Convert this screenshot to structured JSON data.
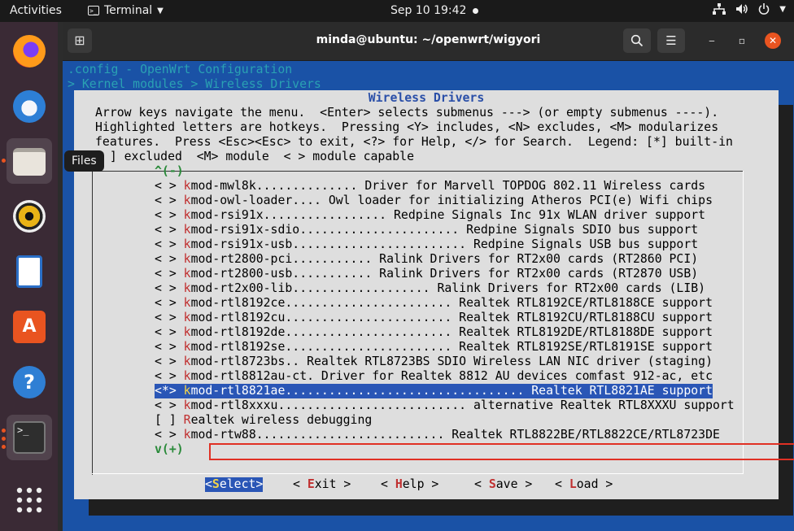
{
  "topbar": {
    "activities": "Activities",
    "app_name": "Terminal",
    "clock": "Sep 10  19:42",
    "tray_icons": [
      "network-icon",
      "volume-icon",
      "power-icon"
    ]
  },
  "dock": {
    "items": [
      "firefox",
      "thunderbird",
      "files",
      "rhythmbox",
      "libreoffice-writer",
      "software",
      "help",
      "terminal",
      "show-apps"
    ],
    "tooltip": "Files"
  },
  "window": {
    "title": "minda@ubuntu: ~/openwrt/wigyori"
  },
  "terminal": {
    "bg_line1": ".config - OpenWrt Configuration",
    "bg_line2": "> Kernel modules > Wireless Drivers",
    "dialog_title": "Wireless Drivers",
    "help_lines": [
      "Arrow keys navigate the menu.  <Enter> selects submenus ---> (or empty submenus ----).",
      "Highlighted letters are hotkeys.  Pressing <Y> includes, <N> excludes, <M> modularizes",
      "features.  Press <Esc><Esc> to exit, <?> for Help, </> for Search.  Legend: [*] built-in",
      "[ ] excluded  <M> module  < > module capable"
    ],
    "scroll_up": "^(-)",
    "scroll_down": "v(+)",
    "items": [
      {
        "prefix": "< > ",
        "hot": "k",
        "rest": "mod-mwl8k.............. Driver for Marvell TOPDOG 802.11 Wireless cards"
      },
      {
        "prefix": "< > ",
        "hot": "k",
        "rest": "mod-owl-loader.... Owl loader for initializing Atheros PCI(e) Wifi chips"
      },
      {
        "prefix": "< > ",
        "hot": "k",
        "rest": "mod-rsi91x................. Redpine Signals Inc 91x WLAN driver support"
      },
      {
        "prefix": "< > ",
        "hot": "k",
        "rest": "mod-rsi91x-sdio...................... Redpine Signals SDIO bus support"
      },
      {
        "prefix": "< > ",
        "hot": "k",
        "rest": "mod-rsi91x-usb........................ Redpine Signals USB bus support"
      },
      {
        "prefix": "< > ",
        "hot": "k",
        "rest": "mod-rt2800-pci........... Ralink Drivers for RT2x00 cards (RT2860 PCI)"
      },
      {
        "prefix": "< > ",
        "hot": "k",
        "rest": "mod-rt2800-usb........... Ralink Drivers for RT2x00 cards (RT2870 USB)"
      },
      {
        "prefix": "< > ",
        "hot": "k",
        "rest": "mod-rt2x00-lib................... Ralink Drivers for RT2x00 cards (LIB)"
      },
      {
        "prefix": "< > ",
        "hot": "k",
        "rest": "mod-rtl8192ce....................... Realtek RTL8192CE/RTL8188CE support"
      },
      {
        "prefix": "< > ",
        "hot": "k",
        "rest": "mod-rtl8192cu....................... Realtek RTL8192CU/RTL8188CU support"
      },
      {
        "prefix": "< > ",
        "hot": "k",
        "rest": "mod-rtl8192de....................... Realtek RTL8192DE/RTL8188DE support"
      },
      {
        "prefix": "< > ",
        "hot": "k",
        "rest": "mod-rtl8192se....................... Realtek RTL8192SE/RTL8191SE support"
      },
      {
        "prefix": "< > ",
        "hot": "k",
        "rest": "mod-rtl8723bs.. Realtek RTL8723BS SDIO Wireless LAN NIC driver (staging)"
      },
      {
        "prefix": "< > ",
        "hot": "k",
        "rest": "mod-rtl8812au-ct. Driver for Realtek 8812 AU devices comfast 912-ac, etc"
      },
      {
        "prefix": "<*> ",
        "hot": "k",
        "rest": "mod-rtl8821ae................................. Realtek RTL8821AE support"
      },
      {
        "prefix": "< > ",
        "hot": "k",
        "rest": "mod-rtl8xxxu.......................... alternative Realtek RTL8XXXU support"
      },
      {
        "prefix": "[ ] ",
        "hot": "R",
        "rest": "ealtek wireless debugging"
      },
      {
        "prefix": "< > ",
        "hot": "k",
        "rest": "mod-rtw88.......................... Realtek RTL8822BE/RTL8822CE/RTL8723DE"
      }
    ],
    "buttons": [
      {
        "pre": "<",
        "hk": "S",
        "post": "elect>"
      },
      {
        "pre": "< ",
        "hk": "E",
        "post": "xit >"
      },
      {
        "pre": "< ",
        "hk": "H",
        "post": "elp >"
      },
      {
        "pre": "< ",
        "hk": "S",
        "post": "ave >"
      },
      {
        "pre": "< ",
        "hk": "L",
        "post": "oad >"
      }
    ]
  },
  "colors": {
    "terminal_bg": "#1a52a6",
    "dialog_bg": "#dedede",
    "selection": "#2a56b6",
    "annotation_box": "#e03024",
    "ubuntu_orange": "#e95420"
  }
}
